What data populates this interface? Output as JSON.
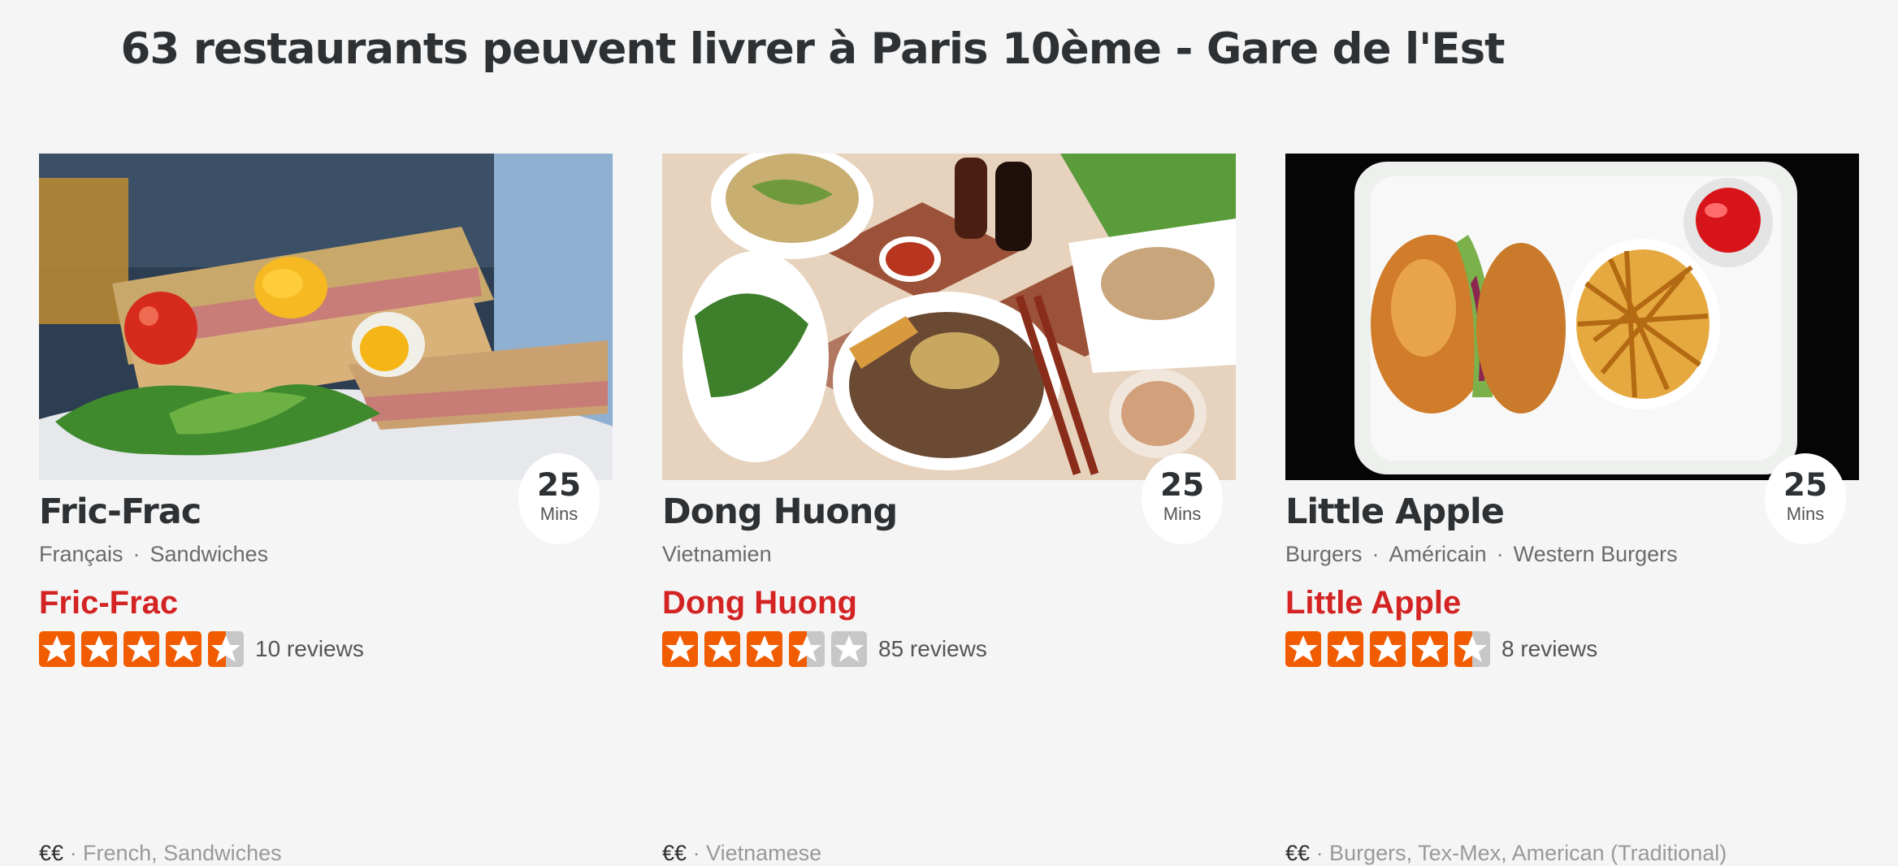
{
  "page": {
    "title": "63 restaurants peuvent livrer à Paris 10ème - Gare de l'Est"
  },
  "colors": {
    "star_fill": "#f15c00",
    "star_empty": "#c7c7c7",
    "yelp_red": "#d32323",
    "background": "#f5f5f5"
  },
  "restaurants": [
    {
      "name": "Fric-Frac",
      "eta_value": "25",
      "eta_unit": "Mins",
      "cuisines": [
        "Français",
        "Sandwiches"
      ],
      "separator": "·",
      "yelp_name": "Fric-Frac",
      "rating": 4.5,
      "reviews": "10 reviews",
      "price": "€€",
      "categories": "· French, Sandwiches",
      "image": "sandwich-photo"
    },
    {
      "name": "Dong Huong",
      "eta_value": "25",
      "eta_unit": "Mins",
      "cuisines": [
        "Vietnamien"
      ],
      "separator": "·",
      "yelp_name": "Dong Huong",
      "rating": 3.5,
      "reviews": "85 reviews",
      "price": "€€",
      "categories": "· Vietnamese",
      "image": "vietnamese-dishes-photo"
    },
    {
      "name": "Little Apple",
      "eta_value": "25",
      "eta_unit": "Mins",
      "cuisines": [
        "Burgers",
        "Américain",
        "Western Burgers"
      ],
      "separator": "·",
      "yelp_name": "Little Apple",
      "rating": 4.5,
      "reviews": "8 reviews",
      "price": "€€",
      "categories": "· Burgers, Tex-Mex, American (Traditional)",
      "image": "burger-fries-photo"
    }
  ]
}
